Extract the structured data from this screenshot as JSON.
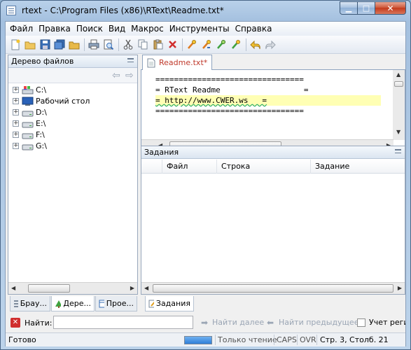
{
  "window": {
    "title": "rtext - C:\\Program Files (x86)\\RText\\Readme.txt*",
    "minimize_glyph": "▁",
    "maximize_glyph": "□",
    "close_glyph": "✕"
  },
  "menu": [
    "Файл",
    "Правка",
    "Поиск",
    "Вид",
    "Макрос",
    "Инструменты",
    "Справка"
  ],
  "toolbar_icons": [
    "new-file-icon",
    "open-folder-icon",
    "save-icon",
    "save-all-icon",
    "open-icon",
    "print-icon",
    "print-preview-icon",
    "cut-icon",
    "copy-icon",
    "paste-icon",
    "delete-icon",
    "find-icon",
    "find-next-icon",
    "replace-icon",
    "replace-next-icon",
    "undo-icon",
    "redo-icon"
  ],
  "file_tree": {
    "title": "Дерево файлов",
    "nav_back": "⇦",
    "nav_forward": "⇨",
    "items": [
      {
        "label": "C:\\",
        "icon": "drive-c-icon"
      },
      {
        "label": "Рабочий стол",
        "icon": "desktop-icon"
      },
      {
        "label": "D:\\",
        "icon": "drive-icon"
      },
      {
        "label": "E:\\",
        "icon": "drive-icon"
      },
      {
        "label": "F:\\",
        "icon": "drive-icon"
      },
      {
        "label": "G:\\",
        "icon": "drive-icon"
      }
    ]
  },
  "editor": {
    "tab_label": "Readme.txt*",
    "lines": [
      "================================",
      "= RText Readme                  =",
      "= http://www.CWER.ws   =",
      "================================"
    ]
  },
  "tasks": {
    "title": "Задания",
    "columns": [
      "Файл",
      "Строка",
      "Задание"
    ]
  },
  "bottom_tabs": {
    "left": [
      "Брау...",
      "Дере...",
      "Прое..."
    ],
    "right": "Задания"
  },
  "find_bar": {
    "label": "Найти:",
    "value": "",
    "next": "Найти далее",
    "prev": "Найти предыдущее",
    "match_case": "Учет регис"
  },
  "status": {
    "text": "Готово",
    "progress": 1.0,
    "mode": "Только чтение",
    "caps": "CAPS",
    "ovr": "OVR",
    "position": "Стр. 3, Столб. 21"
  },
  "colors": {
    "accent": "#2f7fd8",
    "tab_modified": "#c0392b",
    "highlight_line": "#ffffb4"
  }
}
